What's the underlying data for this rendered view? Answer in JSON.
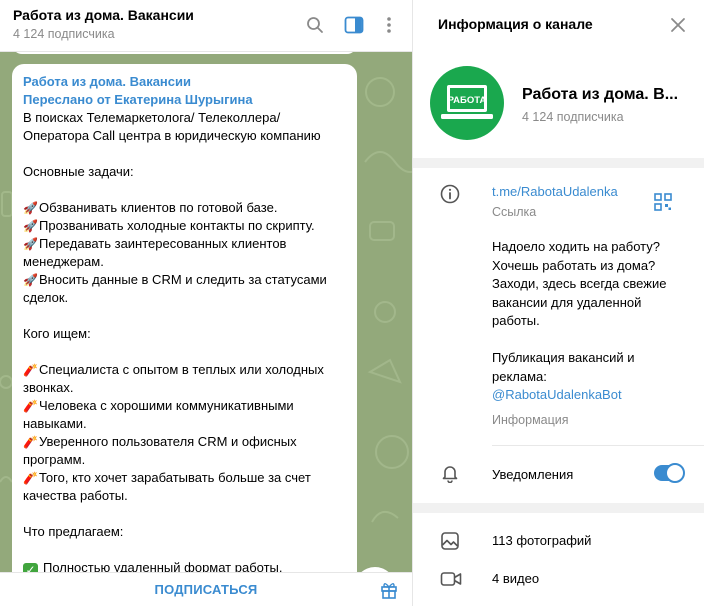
{
  "chat": {
    "title": "Работа из дома. Вакансии",
    "subtitle": "4 124 подписчика",
    "icons": [
      "search-icon",
      "sidebar-toggle-icon",
      "more-vertical-icon"
    ]
  },
  "message": {
    "channel": "Работа из дома. Вакансии",
    "forwarded": "Переслано от Екатерина Шурыгина",
    "lines": [
      {
        "text": "В поисках Телемаркетолога/ Телеколлера/"
      },
      {
        "text": "Оператора Call центра в юридическую компанию"
      },
      {
        "text": ""
      },
      {
        "text": "Основные задачи:"
      },
      {
        "text": ""
      },
      {
        "emoji": "🚀",
        "text": "Обзванивать клиентов по готовой базе."
      },
      {
        "emoji": "🚀",
        "text": "Прозванивать холодные контакты по скрипту."
      },
      {
        "emoji": "🚀",
        "text": "Передавать заинтересованных клиентов"
      },
      {
        "text": "менеджерам."
      },
      {
        "emoji": "🚀",
        "text": "Вносить данные в CRM и следить за статусами"
      },
      {
        "text": "сделок."
      },
      {
        "text": ""
      },
      {
        "text": "Кого ищем:"
      },
      {
        "text": ""
      },
      {
        "emoji": "🧨",
        "text": "Специалиста с опытом в теплых или холодных"
      },
      {
        "text": "звонках."
      },
      {
        "emoji": "🧨",
        "text": "Человека с хорошими коммуникативными"
      },
      {
        "text": "навыками."
      },
      {
        "emoji": "🧨",
        "text": "Уверенного пользователя CRM и офисных"
      },
      {
        "text": "программ."
      },
      {
        "emoji": "🧨",
        "text": "Того, кто хочет зарабатывать больше за счет"
      },
      {
        "text": "качества работы."
      },
      {
        "text": ""
      },
      {
        "text": "Что предлагаем:"
      },
      {
        "text": ""
      },
      {
        "check": "✓",
        "text": "Полностью удаленный формат работы."
      }
    ]
  },
  "footer": {
    "subscribe": "ПОДПИСАТЬСЯ"
  },
  "info": {
    "title": "Информация о канале",
    "avatar_text": "РАБОТА",
    "name": "Работа из дома. В...",
    "subscribers": "4 124 подписчика",
    "link": "t.me/RabotaUdalenka",
    "link_label": "Ссылка",
    "description": [
      "Надоело ходить на работу?",
      "Хочешь работать из дома?",
      "Заходи, здесь всегда свежие",
      "вакансии для удаленной",
      "работы.",
      "",
      "Публикация вакансий и",
      "реклама:"
    ],
    "mention": "@RabotaUdalenkaBot",
    "description_label": "Информация",
    "notifications": "Уведомления",
    "notifications_on": true,
    "photos": "113 фотографий",
    "videos": "4 видео"
  },
  "colors": {
    "accent": "#3a8bd0",
    "chat_bg": "#93a97b",
    "avatar": "#1aa84e"
  }
}
